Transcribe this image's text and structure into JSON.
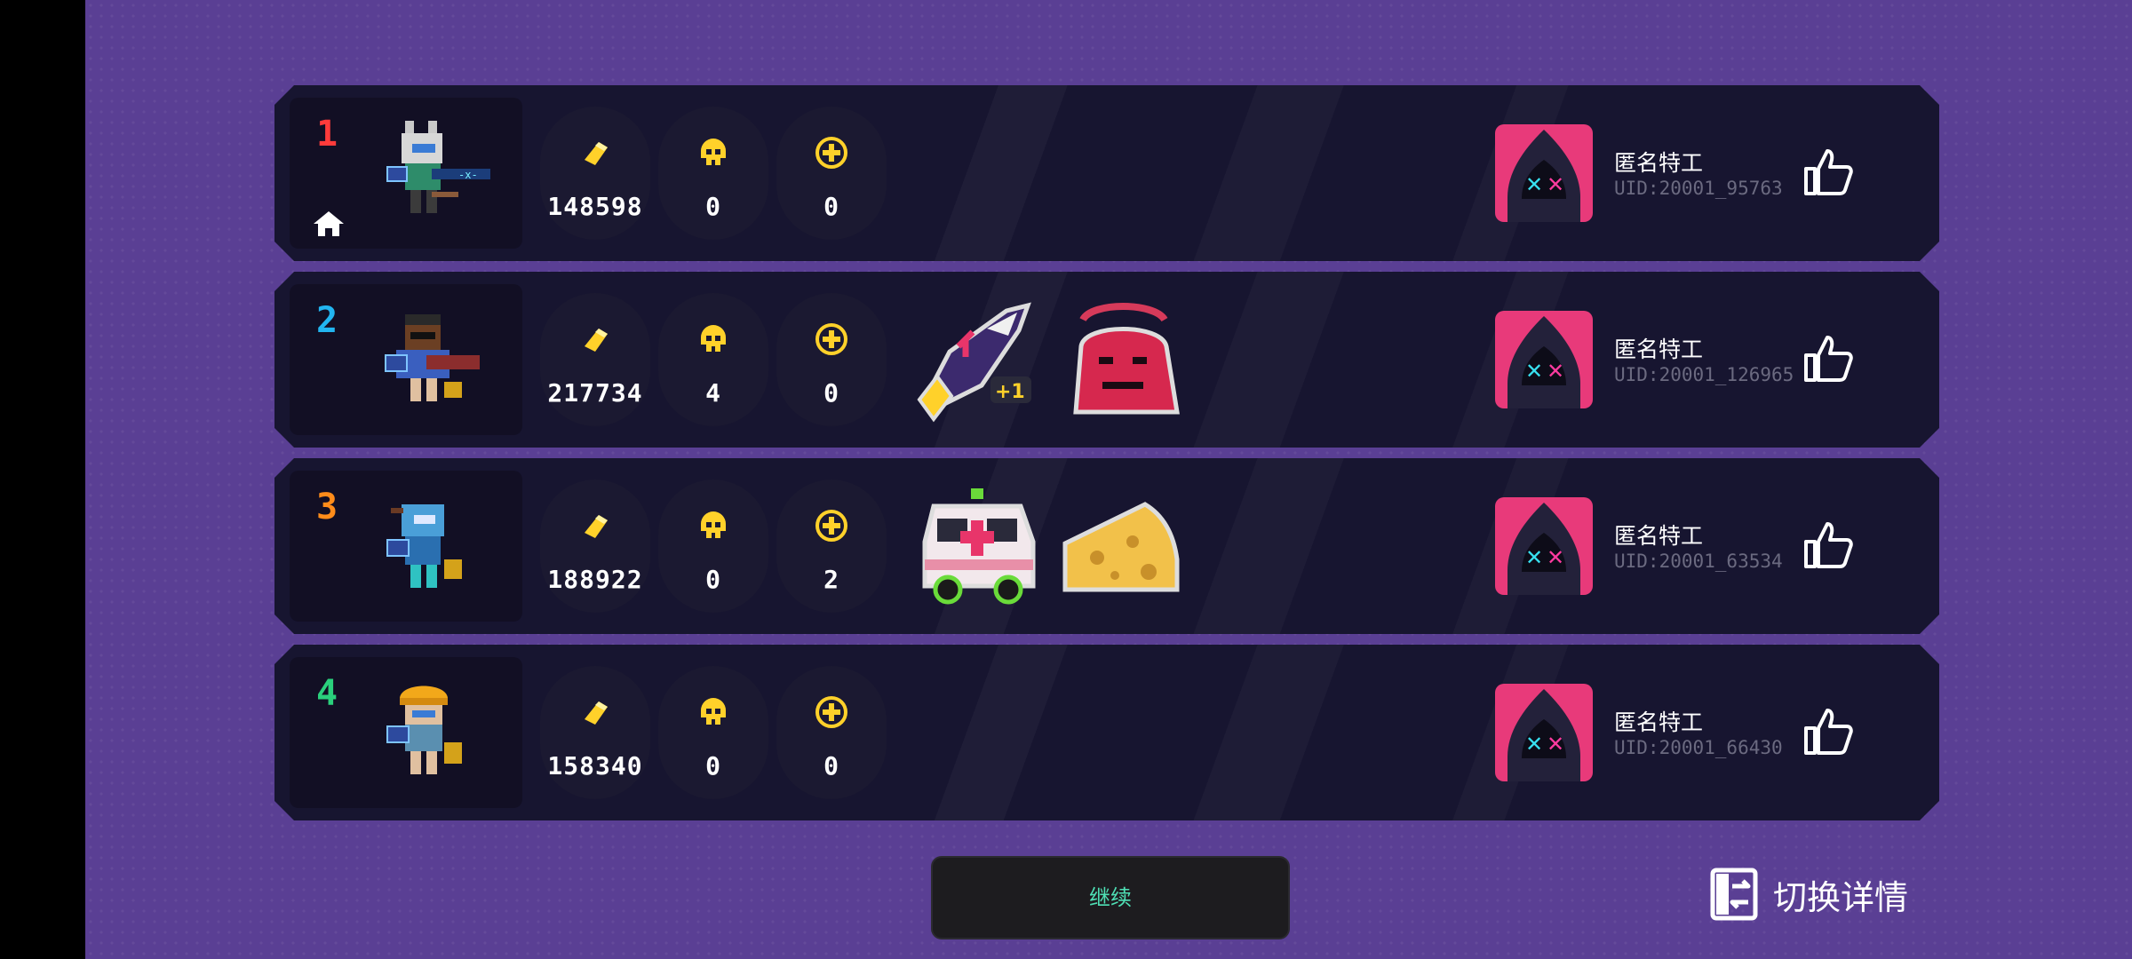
{
  "players": [
    {
      "rank": "1",
      "rank_color": "#ff3b3b",
      "host": true,
      "char_name": "wolf-knight-icon",
      "gold": "148598",
      "kills": "0",
      "revives": "0",
      "buffs": [],
      "name": "匿名特工",
      "uid": "UID:20001_95763"
    },
    {
      "rank": "2",
      "rank_color": "#22b5f0",
      "host": false,
      "char_name": "gunner-icon",
      "gold": "217734",
      "kills": "4",
      "revives": "0",
      "buffs": [
        "shark-rocket-plus1-icon",
        "red-demon-icon"
      ],
      "name": "匿名特工",
      "uid": "UID:20001_126965"
    },
    {
      "rank": "3",
      "rank_color": "#ff8c1a",
      "host": false,
      "char_name": "blue-elf-icon",
      "gold": "188922",
      "kills": "0",
      "revives": "2",
      "buffs": [
        "ambulance-icon",
        "cheese-icon"
      ],
      "name": "匿名特工",
      "uid": "UID:20001_63534"
    },
    {
      "rank": "4",
      "rank_color": "#2ad07c",
      "host": false,
      "char_name": "engineer-icon",
      "gold": "158340",
      "kills": "0",
      "revives": "0",
      "buffs": [],
      "name": "匿名特工",
      "uid": "UID:20001_66430"
    }
  ],
  "continue_label": "继续",
  "switch_label": "切换详情",
  "colors": {
    "background": "#5a3f94",
    "panel": "#171530",
    "gold": "#ffd12a",
    "accent": "#4fe0b5"
  }
}
